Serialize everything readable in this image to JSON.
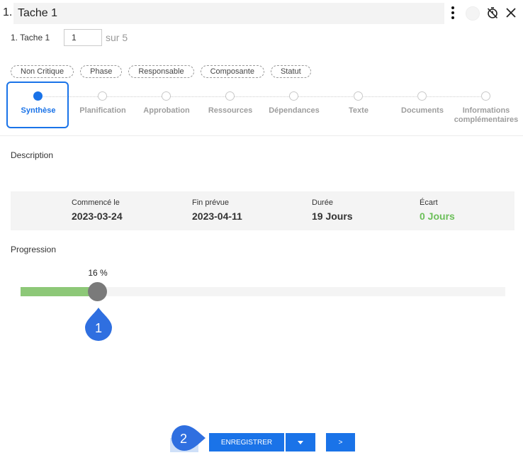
{
  "header": {
    "prefix": "1.",
    "title_value": "Tache 1"
  },
  "subheader": {
    "task_label": "1. Tache 1",
    "page_value": "1",
    "page_total": "sur 5"
  },
  "tags": [
    {
      "label": "Non Critique"
    },
    {
      "label": "Phase"
    },
    {
      "label": "Responsable"
    },
    {
      "label": "Composante"
    },
    {
      "label": "Statut"
    }
  ],
  "steps": [
    {
      "label": "Synthèse",
      "active": true
    },
    {
      "label": "Planification",
      "active": false
    },
    {
      "label": "Approbation",
      "active": false
    },
    {
      "label": "Ressources",
      "active": false
    },
    {
      "label": "Dépendances",
      "active": false
    },
    {
      "label": "Texte",
      "active": false
    },
    {
      "label": "Documents",
      "active": false
    },
    {
      "label": "Informations complémentaires",
      "active": false
    }
  ],
  "description": {
    "label": "Description"
  },
  "info": {
    "started_label": "Commencé le",
    "started_value": "2023-03-24",
    "end_label": "Fin prévue",
    "end_value": "2023-04-11",
    "duration_label": "Durée",
    "duration_value": "19 Jours",
    "gap_label": "Écart",
    "gap_value": "0 Jours"
  },
  "progression": {
    "label": "Progression",
    "percent_text": "16 %",
    "value": 0.16
  },
  "markers": {
    "m1": "1",
    "m2": "2"
  },
  "footer": {
    "save_label": "ENREGISTRER",
    "next_label": ">"
  },
  "colors": {
    "accent": "#1a73e8",
    "progress": "#8dc878",
    "ok": "#6bbf59",
    "marker": "#2f6fe0"
  }
}
